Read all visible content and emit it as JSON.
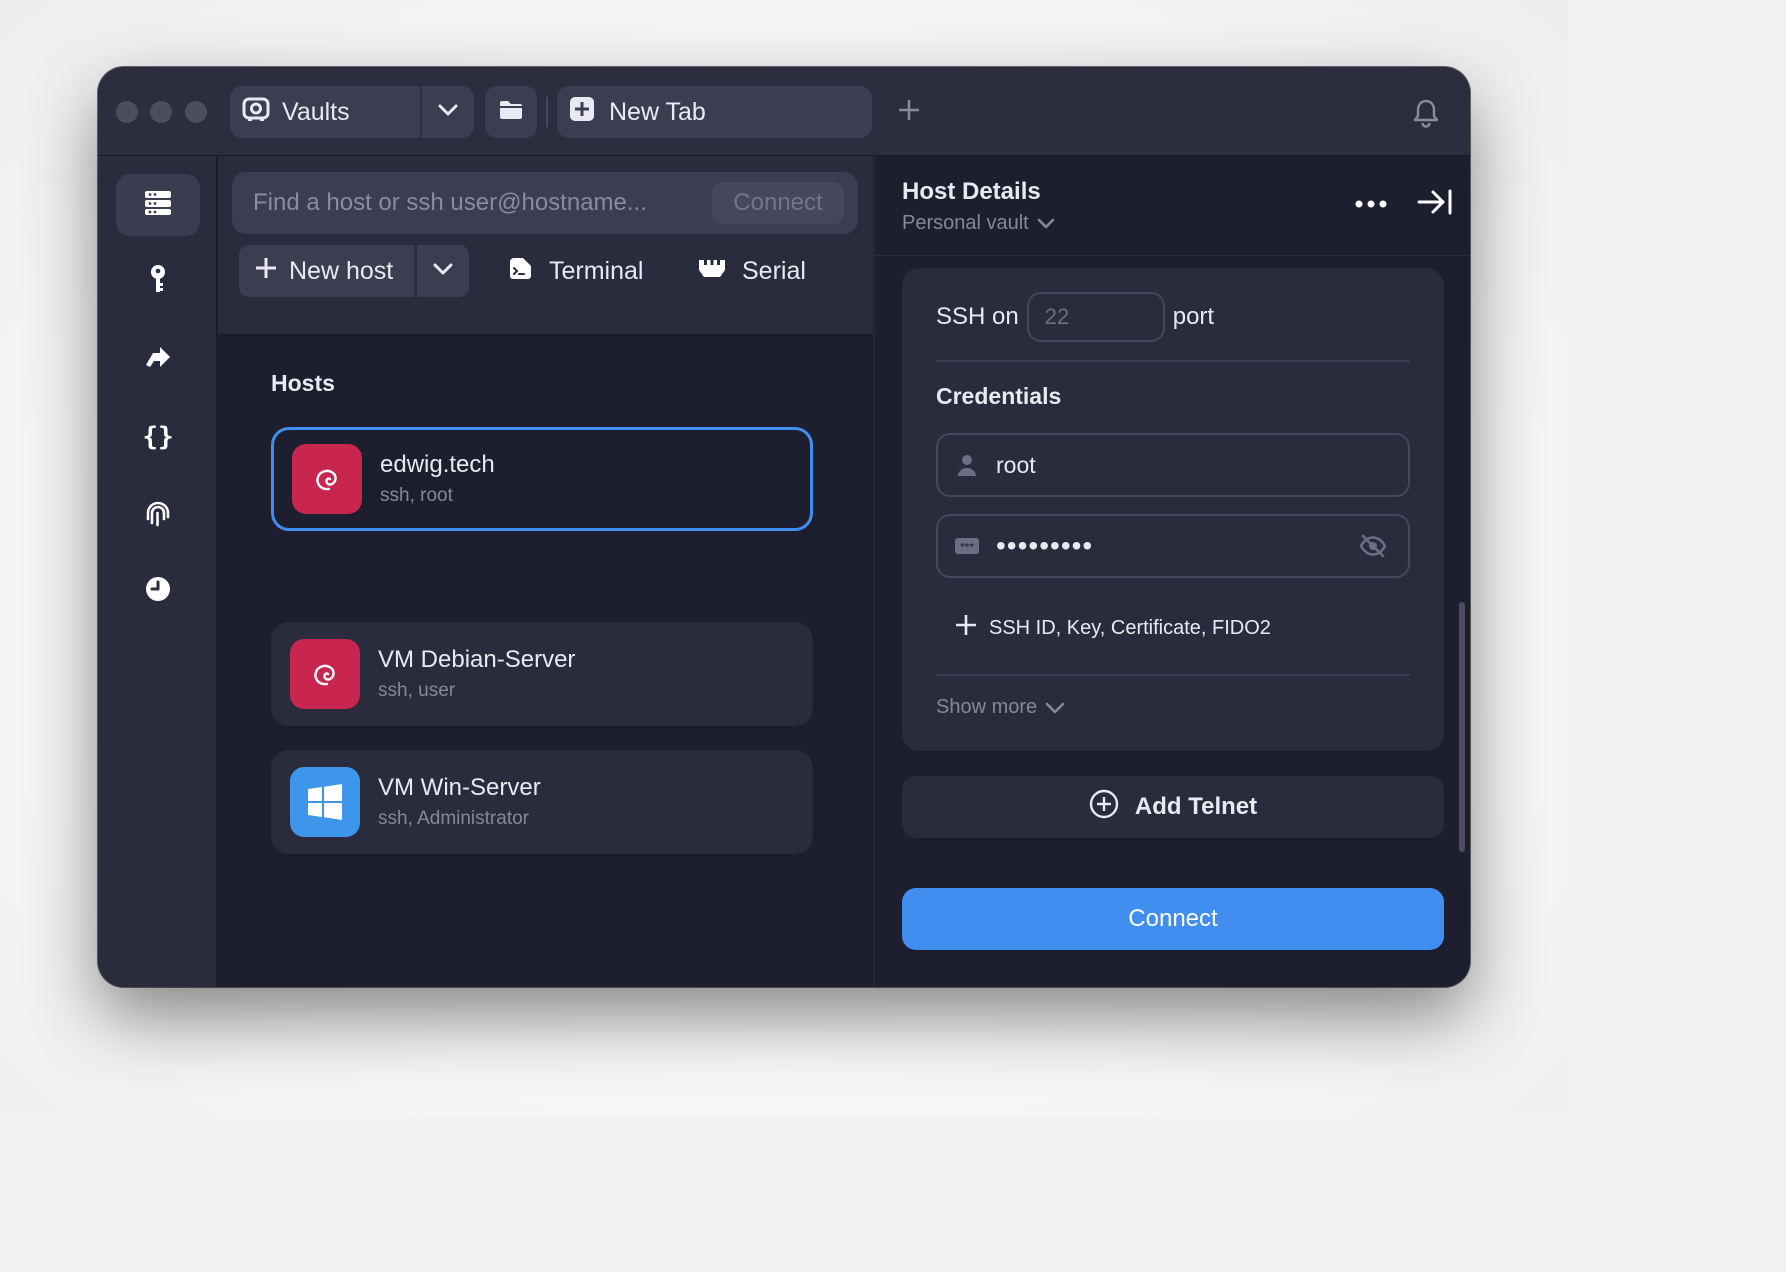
{
  "titlebar": {
    "vaults_label": "Vaults",
    "tab_label": "New Tab"
  },
  "search": {
    "placeholder": "Find a host or ssh user@hostname...",
    "connect_label": "Connect"
  },
  "toolbar": {
    "new_host_label": "New host",
    "terminal_label": "Terminal",
    "serial_label": "Serial"
  },
  "hosts": {
    "heading": "Hosts",
    "items": [
      {
        "name": "edwig.tech",
        "subtitle": "ssh, root",
        "os": "debian",
        "selected": true
      },
      {
        "name": "VM Debian-Server",
        "subtitle": "ssh, user",
        "os": "debian",
        "selected": false
      },
      {
        "name": "VM Win-Server",
        "subtitle": "ssh, Administrator",
        "os": "windows",
        "selected": false
      }
    ]
  },
  "details": {
    "title": "Host Details",
    "vault": "Personal vault",
    "ssh_prefix": "SSH on",
    "port_placeholder": "22",
    "ssh_suffix": "port",
    "credentials_heading": "Credentials",
    "username": "root",
    "password_mask": "•••••••••",
    "add_credentials_label": "SSH ID, Key, Certificate, FIDO2",
    "show_more_label": "Show more",
    "add_telnet_label": "Add Telnet",
    "connect_label": "Connect"
  },
  "colors": {
    "accent": "#3f8ef0",
    "debian_icon_bg": "#c8254f",
    "windows_icon_bg": "#3d96ea",
    "window_bg": "#1d1f2e",
    "panel_bg": "#2a2c3d"
  },
  "icons": {
    "rail": [
      "hosts-icon",
      "keychain-icon",
      "port-forwarding-icon",
      "snippets-icon",
      "known-hosts-icon",
      "history-icon"
    ]
  }
}
